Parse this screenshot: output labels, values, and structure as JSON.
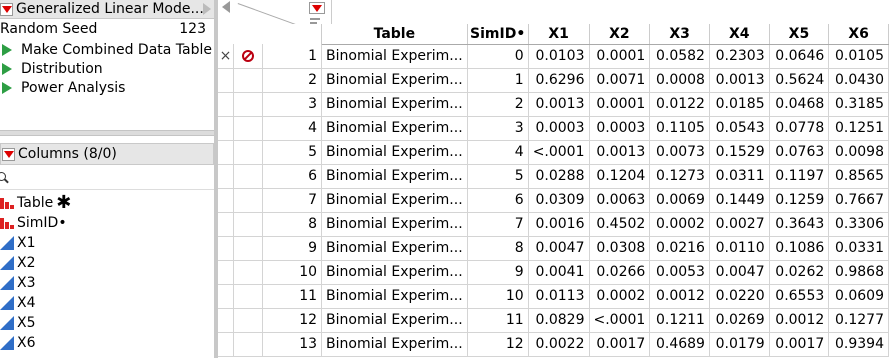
{
  "table_panel": {
    "title": "Generalized Linear Mode...",
    "seed_label": "Random Seed",
    "seed_value": "123",
    "scripts": [
      "Make Combined Data Table",
      "Distribution",
      "Power Analysis"
    ]
  },
  "columns_panel": {
    "header": "Columns (8/0)",
    "items": [
      {
        "name": "Table",
        "type": "nominal",
        "marker": "✱"
      },
      {
        "name": "SimID•",
        "type": "nominal"
      },
      {
        "name": "X1",
        "type": "continuous"
      },
      {
        "name": "X2",
        "type": "continuous"
      },
      {
        "name": "X3",
        "type": "continuous"
      },
      {
        "name": "X4",
        "type": "continuous"
      },
      {
        "name": "X5",
        "type": "continuous"
      },
      {
        "name": "X6",
        "type": "continuous"
      }
    ]
  },
  "grid": {
    "headers": [
      "Table",
      "SimID•",
      "X1",
      "X2",
      "X3",
      "X4",
      "X5",
      "X6"
    ],
    "rows": [
      {
        "n": "1",
        "table": "Binomial Experim...",
        "simid": "0",
        "x": [
          "0.0103",
          "0.0001",
          "0.0582",
          "0.2303",
          "0.0646",
          "0.0105"
        ],
        "mark": "×",
        "excluded": true
      },
      {
        "n": "2",
        "table": "Binomial Experim...",
        "simid": "1",
        "x": [
          "0.6296",
          "0.0071",
          "0.0008",
          "0.0013",
          "0.5624",
          "0.0430"
        ]
      },
      {
        "n": "3",
        "table": "Binomial Experim...",
        "simid": "2",
        "x": [
          "0.0013",
          "0.0001",
          "0.0122",
          "0.0185",
          "0.0468",
          "0.3185"
        ]
      },
      {
        "n": "4",
        "table": "Binomial Experim...",
        "simid": "3",
        "x": [
          "0.0003",
          "0.0003",
          "0.1105",
          "0.0543",
          "0.0778",
          "0.1251"
        ]
      },
      {
        "n": "5",
        "table": "Binomial Experim...",
        "simid": "4",
        "x": [
          "<.0001",
          "0.0013",
          "0.0073",
          "0.1529",
          "0.0763",
          "0.0098"
        ]
      },
      {
        "n": "6",
        "table": "Binomial Experim...",
        "simid": "5",
        "x": [
          "0.0288",
          "0.1204",
          "0.1273",
          "0.0311",
          "0.1197",
          "0.8565"
        ]
      },
      {
        "n": "7",
        "table": "Binomial Experim...",
        "simid": "6",
        "x": [
          "0.0309",
          "0.0063",
          "0.0069",
          "0.1449",
          "0.1259",
          "0.7667"
        ]
      },
      {
        "n": "8",
        "table": "Binomial Experim...",
        "simid": "7",
        "x": [
          "0.0016",
          "0.4502",
          "0.0002",
          "0.0027",
          "0.3643",
          "0.3306"
        ]
      },
      {
        "n": "9",
        "table": "Binomial Experim...",
        "simid": "8",
        "x": [
          "0.0047",
          "0.0308",
          "0.0216",
          "0.0110",
          "0.1086",
          "0.0331"
        ]
      },
      {
        "n": "10",
        "table": "Binomial Experim...",
        "simid": "9",
        "x": [
          "0.0041",
          "0.0266",
          "0.0053",
          "0.0047",
          "0.0262",
          "0.9868"
        ]
      },
      {
        "n": "11",
        "table": "Binomial Experim...",
        "simid": "10",
        "x": [
          "0.0113",
          "0.0002",
          "0.0012",
          "0.0220",
          "0.6553",
          "0.0609"
        ]
      },
      {
        "n": "12",
        "table": "Binomial Experim...",
        "simid": "11",
        "x": [
          "0.0829",
          "<.0001",
          "0.1211",
          "0.0269",
          "0.0012",
          "0.1277"
        ]
      },
      {
        "n": "13",
        "table": "Binomial Experim...",
        "simid": "12",
        "x": [
          "0.0022",
          "0.0017",
          "0.4689",
          "0.0179",
          "0.0017",
          "0.9394"
        ]
      }
    ]
  },
  "colors": {
    "accent_red": "#dd0000",
    "script_green": "#2e9e44",
    "continuous_blue": "#2f6ec7"
  }
}
